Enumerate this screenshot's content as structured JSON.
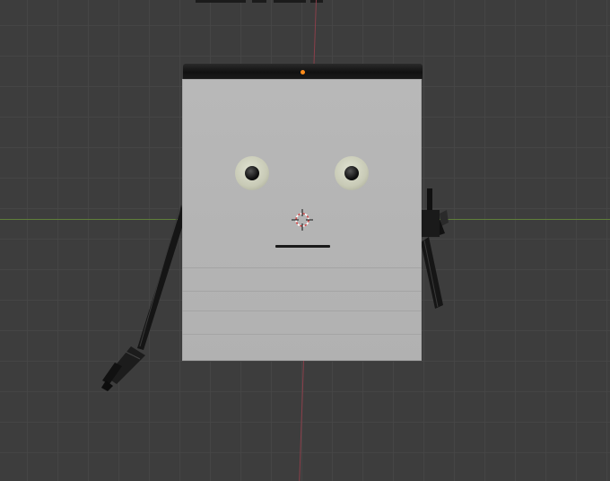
{
  "viewport": {
    "background": "#3d3d3d",
    "grid_color": "#464646",
    "x_axis_color": "#5f7f3a",
    "y_axis_color": "#8a3f4a"
  },
  "robot": {
    "body_color": "#b5b5b5",
    "top_bar_color": "#151515",
    "eye_color": "#c8cab6",
    "pupil_color": "#111111",
    "arm_color": "#141414",
    "origin_color": "#ff8c1a"
  },
  "icons": {
    "cursor": "3d-cursor-icon",
    "origin": "object-origin-icon"
  }
}
